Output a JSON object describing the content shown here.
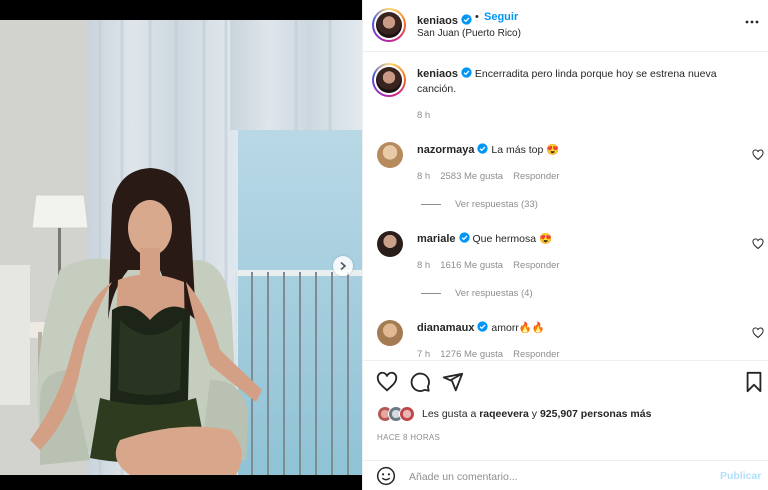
{
  "post": {
    "author": "keniaos",
    "follow_label": "Seguir",
    "separator": "•",
    "location": "San Juan (Puerto Rico)",
    "media_index": 1,
    "media_count": 3
  },
  "caption": {
    "author": "keniaos",
    "text": "Encerradita pero linda porque hoy se estrena nueva canción.",
    "time": "8 h"
  },
  "comments": [
    {
      "user": "nazormaya",
      "text": "La más top",
      "emoji": "😍",
      "time": "8 h",
      "likes": "2583 Me gusta",
      "reply": "Responder",
      "view_replies": "Ver respuestas (33)"
    },
    {
      "user": "mariale",
      "text": "Que hermosa",
      "emoji": "😍",
      "time": "8 h",
      "likes": "1616 Me gusta",
      "reply": "Responder",
      "view_replies": "Ver respuestas (4)"
    },
    {
      "user": "dianamaux",
      "text": "amorr",
      "emoji": "🔥🔥",
      "time": "7 h",
      "likes": "1276 Me gusta",
      "reply": "Responder"
    }
  ],
  "likes": {
    "prefix": "Les gusta a",
    "user": "raqeevera",
    "conj": "y",
    "count": "925,907 personas más"
  },
  "posted_ago": "HACE 8 HORAS",
  "add_comment": {
    "placeholder": "Añade un comentario...",
    "publish_label": "Publicar"
  },
  "colors": {
    "accent": "#0095f6",
    "publish_disabled": "#b2dffc",
    "secondary_text": "#8e8e8e",
    "verified": "#0095f6"
  },
  "icons": [
    "verified-badge-icon",
    "more-options-icon",
    "heart-icon",
    "comment-icon",
    "share-icon",
    "bookmark-icon",
    "emoji-icon",
    "chevron-right-icon"
  ]
}
